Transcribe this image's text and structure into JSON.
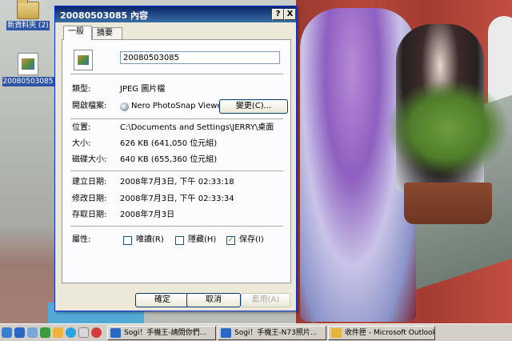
{
  "desktop": {
    "icons": [
      {
        "label": "新資料夾 (2)",
        "icon": "folder-icon"
      },
      {
        "label": "20080503085",
        "icon": "image-file-icon"
      }
    ]
  },
  "dialog": {
    "title": "20080503085 內容",
    "help_button": "?",
    "close_button": "X",
    "tabs": [
      "一般",
      "摘要"
    ],
    "file_name_value": "20080503085",
    "type_label": "類型:",
    "type_value": "JPEG 圖片檔",
    "opens_with_label": "開啟檔案:",
    "opens_with_value": "Nero PhotoSnap Viewer",
    "change_button": "變更(C)...",
    "location_label": "位置:",
    "location_value": "C:\\Documents and Settings\\JERRY\\桌面",
    "size_label": "大小:",
    "size_value": "626 KB (641,050 位元組)",
    "size_on_disk_label": "磁碟大小:",
    "size_on_disk_value": "640 KB (655,360 位元組)",
    "created_label": "建立日期:",
    "created_value": "2008年7月3日, 下午 02:33:18",
    "modified_label": "修改日期:",
    "modified_value": "2008年7月3日, 下午 02:33:34",
    "accessed_label": "存取日期:",
    "accessed_value": "2008年7月3日",
    "attributes_label": "屬性:",
    "attributes": [
      {
        "label": "唯讀(R)",
        "checked": false
      },
      {
        "label": "隱藏(H)",
        "checked": false
      },
      {
        "label": "保存(I)",
        "checked": true
      }
    ],
    "ok_button": "確定",
    "cancel_button": "取消",
    "apply_button": "套用(A)"
  },
  "taskbar": {
    "buttons": [
      {
        "label": "Sogi！手機王-請問你們...",
        "icon": "ie-icon"
      },
      {
        "label": "Sogi！手機王-N73照片...",
        "icon": "ie-icon"
      },
      {
        "label": "收件匣 - Microsoft Outlook",
        "icon": "outlook-icon"
      }
    ]
  },
  "colors": {
    "titlebar": "#0a246a",
    "dialog_bg": "#ece9d8",
    "desktop_selection": "#2f54a8"
  }
}
